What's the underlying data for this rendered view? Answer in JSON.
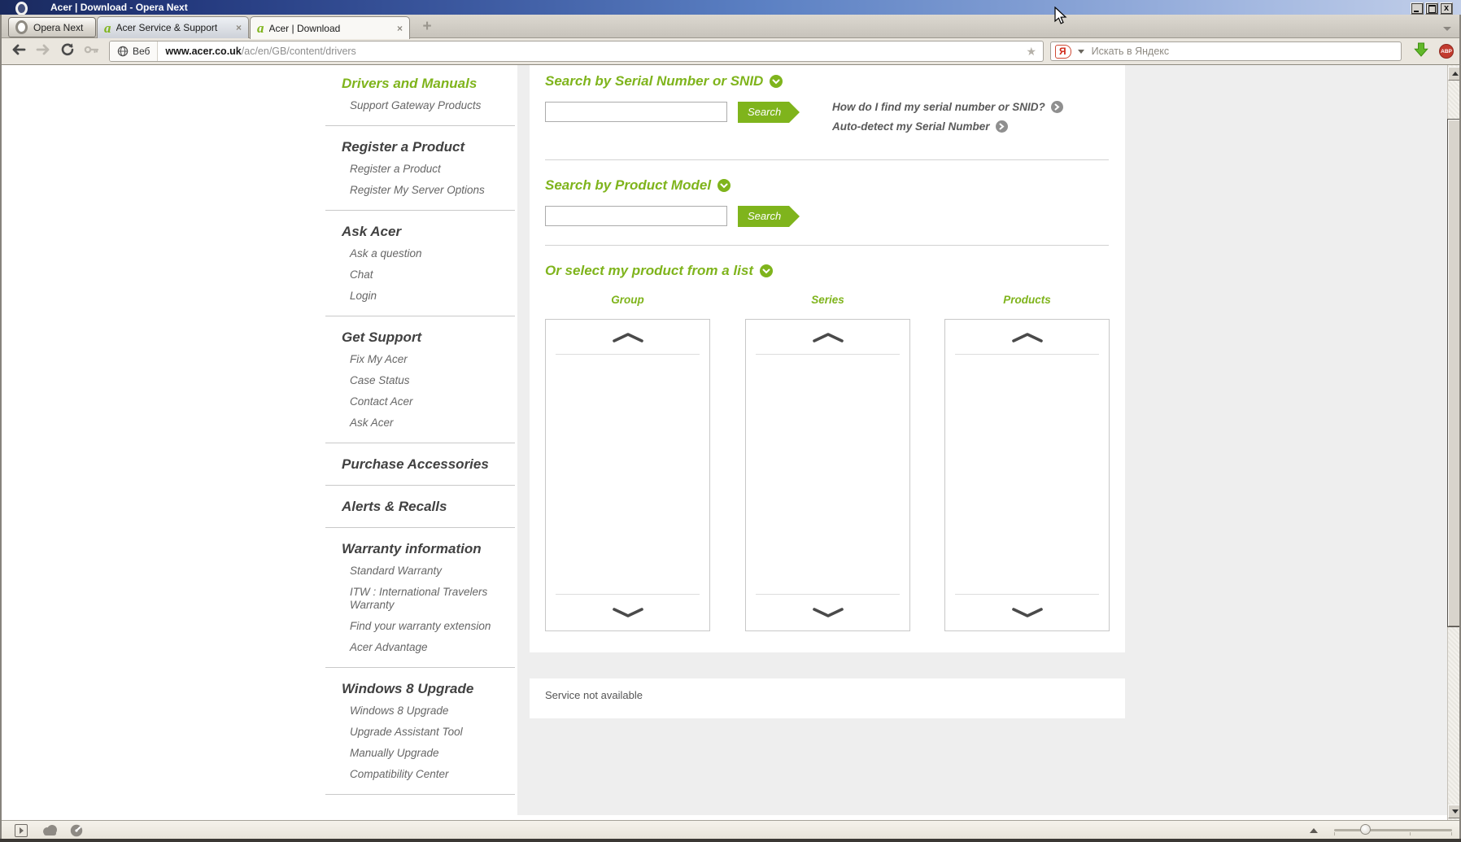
{
  "window": {
    "title": "Acer | Download - Opera Next"
  },
  "tabs": {
    "menu_button": "Opera Next",
    "items": [
      {
        "label": "Acer Service & Support",
        "active": false
      },
      {
        "label": "Acer | Download",
        "active": true
      }
    ],
    "close_glyph": "×",
    "new_tab_glyph": "+"
  },
  "addressbar": {
    "badge": "Веб",
    "url_domain": "www.acer.co.uk",
    "url_path": "/ac/en/GB/content/drivers",
    "bookmark_star_glyph": "★",
    "search_engine_letter": "Я",
    "search_placeholder": "Искать в Яндекс",
    "adblock_label": "ABP"
  },
  "sidebar": {
    "sections": [
      {
        "title": "Drivers and Manuals",
        "highlighted": true,
        "items": [
          "Support Gateway Products"
        ]
      },
      {
        "title": "Register a Product",
        "highlighted": false,
        "items": [
          "Register a Product",
          "Register My Server Options"
        ]
      },
      {
        "title": "Ask Acer",
        "highlighted": false,
        "items": [
          "Ask a question",
          "Chat",
          "Login"
        ]
      },
      {
        "title": "Get Support",
        "highlighted": false,
        "items": [
          "Fix My Acer",
          "Case Status",
          "Contact Acer",
          "Ask Acer"
        ]
      },
      {
        "title": "Purchase Accessories",
        "highlighted": false,
        "items": []
      },
      {
        "title": "Alerts & Recalls",
        "highlighted": false,
        "items": []
      },
      {
        "title": "Warranty information",
        "highlighted": false,
        "items": [
          "Standard Warranty",
          "ITW : International Travelers Warranty",
          "Find your warranty extension",
          "Acer Advantage"
        ]
      },
      {
        "title": "Windows 8 Upgrade",
        "highlighted": false,
        "items": [
          "Windows 8 Upgrade",
          "Upgrade Assistant Tool",
          "Manually Upgrade",
          "Compatibility Center"
        ]
      }
    ]
  },
  "main": {
    "serial_section": {
      "title": "Search by Serial Number or SNID",
      "input_value": "",
      "search_label": "Search",
      "links": [
        "How do I find my serial number or SNID?",
        "Auto-detect my Serial Number"
      ]
    },
    "model_section": {
      "title": "Search by Product Model",
      "input_value": "",
      "search_label": "Search"
    },
    "list_section": {
      "title": "Or select my product from a list",
      "columns": [
        "Group",
        "Series",
        "Products"
      ]
    },
    "service_notice": "Service not available"
  },
  "colors": {
    "accent_green": "#7fb41c",
    "titlebar_blue_dark": "#1a2a5e",
    "titlebar_blue_light": "#c2cfe9",
    "content_gray": "#eeeeee"
  },
  "icons": {
    "opera_logo": "white O ring",
    "acer_favicon": "green italic a",
    "heading_chevron": "green circle chevron-down",
    "link_arrow": "gray circle chevron-right",
    "download_arrow": "green down arrow",
    "scroll_chevrons": "wide gray carets",
    "statusbar": [
      "panel-toggle",
      "cloud",
      "turbo-gauge",
      "zoom-slider"
    ]
  }
}
